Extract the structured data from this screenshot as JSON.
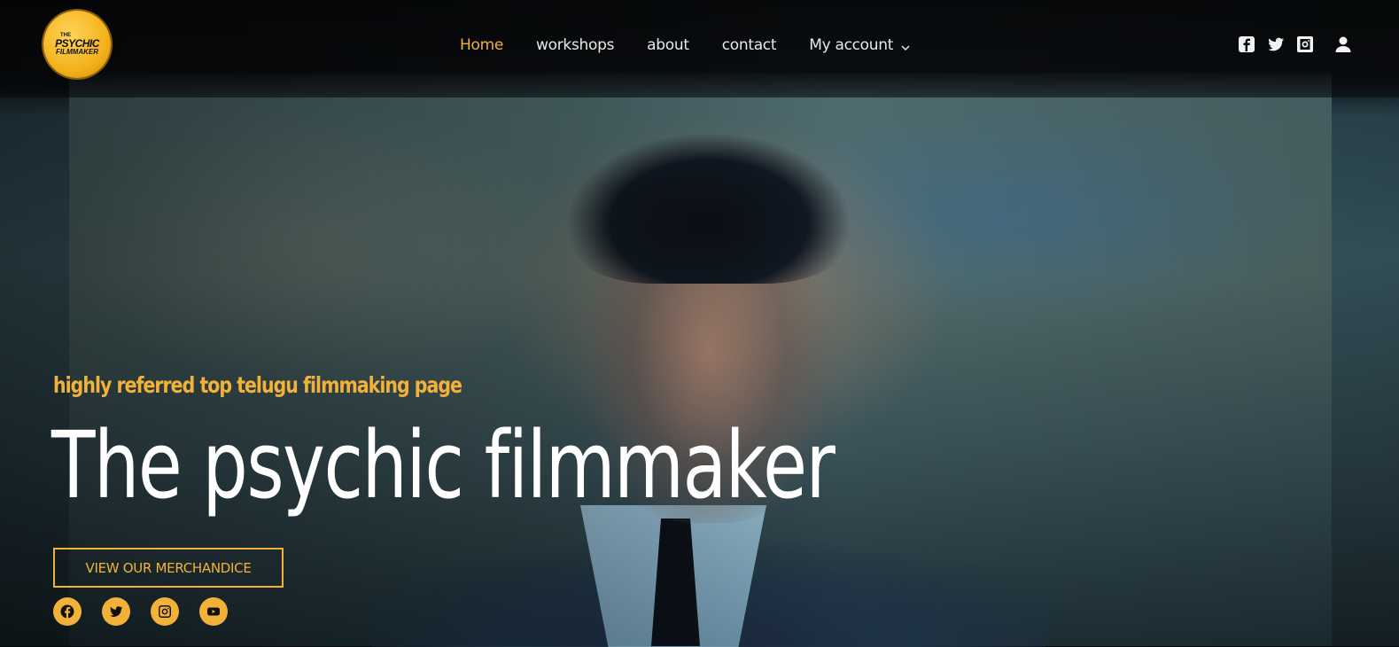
{
  "logo": {
    "line1": "THE",
    "line2": "PSYCHIC",
    "line3": "FILMMAKER"
  },
  "nav": {
    "items": [
      {
        "label": "Home",
        "active": true
      },
      {
        "label": "workshops"
      },
      {
        "label": "about"
      },
      {
        "label": "contact"
      },
      {
        "label": "My account",
        "has_dropdown": true
      }
    ]
  },
  "header_icons": [
    "facebook-square-icon",
    "twitter-icon",
    "instagram-icon",
    "user-icon"
  ],
  "hero": {
    "tagline": "highly referred top telugu filmmaking page",
    "title": "The psychic filmmaker",
    "button_label": "VIEW OUR MERCHANDICE"
  },
  "socials": [
    "facebook-icon",
    "twitter-icon",
    "instagram-icon",
    "youtube-icon"
  ],
  "colors": {
    "accent": "#f2b23a",
    "nav_text": "#e9e9e9",
    "background": "#05080a"
  }
}
